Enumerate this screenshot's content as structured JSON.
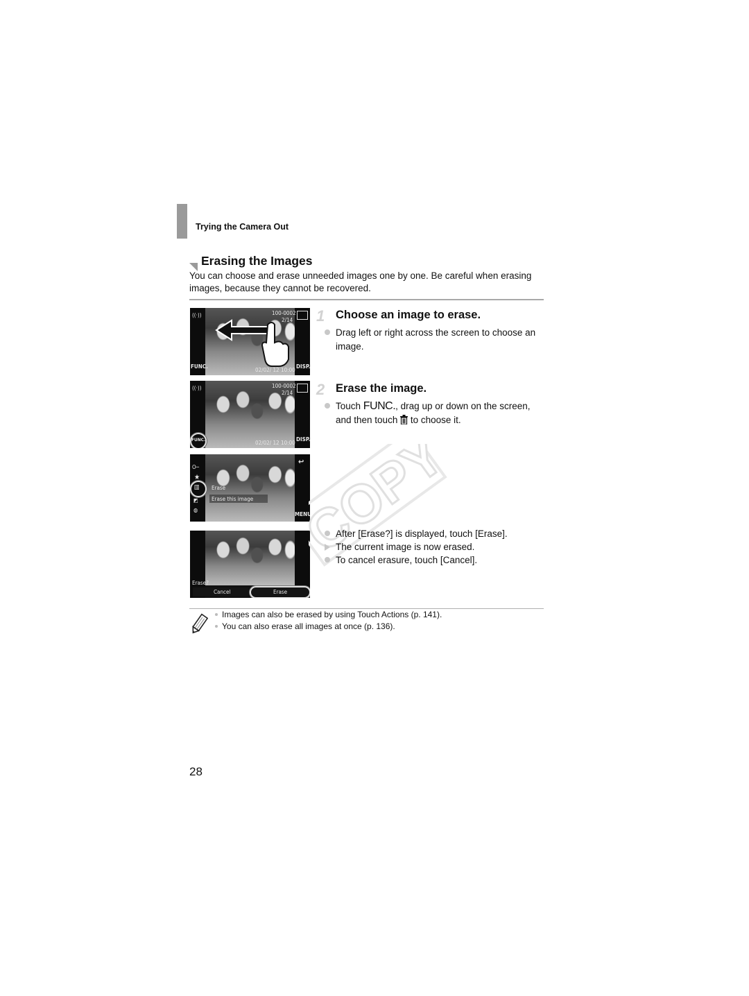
{
  "header": {
    "section_label": "Trying the Camera Out"
  },
  "title": "Erasing the Images",
  "intro": "You can choose and erase unneeded images one by one. Be careful when erasing images, because they cannot be recovered.",
  "steps": [
    {
      "number": "1",
      "title": "Choose an image to erase.",
      "bullets": [
        {
          "type": "action",
          "text": "Drag left or right across the screen to choose an image."
        }
      ]
    },
    {
      "number": "2",
      "title": "Erase the image.",
      "bullets": [
        {
          "type": "action",
          "text_before": "Touch ",
          "func_label": "FUNC.",
          "text_middle": ", drag up or down on the screen, and then touch ",
          "icon": "trash-icon",
          "text_after": " to choose it."
        }
      ],
      "followup_bullets": [
        {
          "type": "action",
          "text": "After [Erase?] is displayed, touch [Erase]."
        },
        {
          "type": "result",
          "text": "The current image is now erased."
        },
        {
          "type": "action",
          "text": "To cancel erasure, touch [Cancel]."
        }
      ]
    }
  ],
  "screens": {
    "screen1": {
      "wifi": "((·))",
      "file_number": "100-0002",
      "counter": "2/14",
      "func": "FUNC.",
      "disp": "DISP.",
      "date": "02/02/ 12",
      "time": "10:00",
      "gesture": "swipe-left"
    },
    "screen2": {
      "wifi": "((·))",
      "file_number": "100-0002",
      "counter": "2/14",
      "func": "FUNC.",
      "disp": "DISP.",
      "date": "02/02/ 12",
      "time": "10:00"
    },
    "screen3": {
      "menu_item": "Erase",
      "menu_hint": "Erase this image",
      "menu_label": "MENU",
      "key_icon": "O─"
    },
    "screen4": {
      "prompt": "Erase?",
      "cancel": "Cancel",
      "erase": "Erase"
    }
  },
  "watermark": "COPY",
  "notes": [
    "Images can also be erased by using Touch Actions (p. 141).",
    "You can also erase all images at once (p. 136)."
  ],
  "page_number": "28"
}
